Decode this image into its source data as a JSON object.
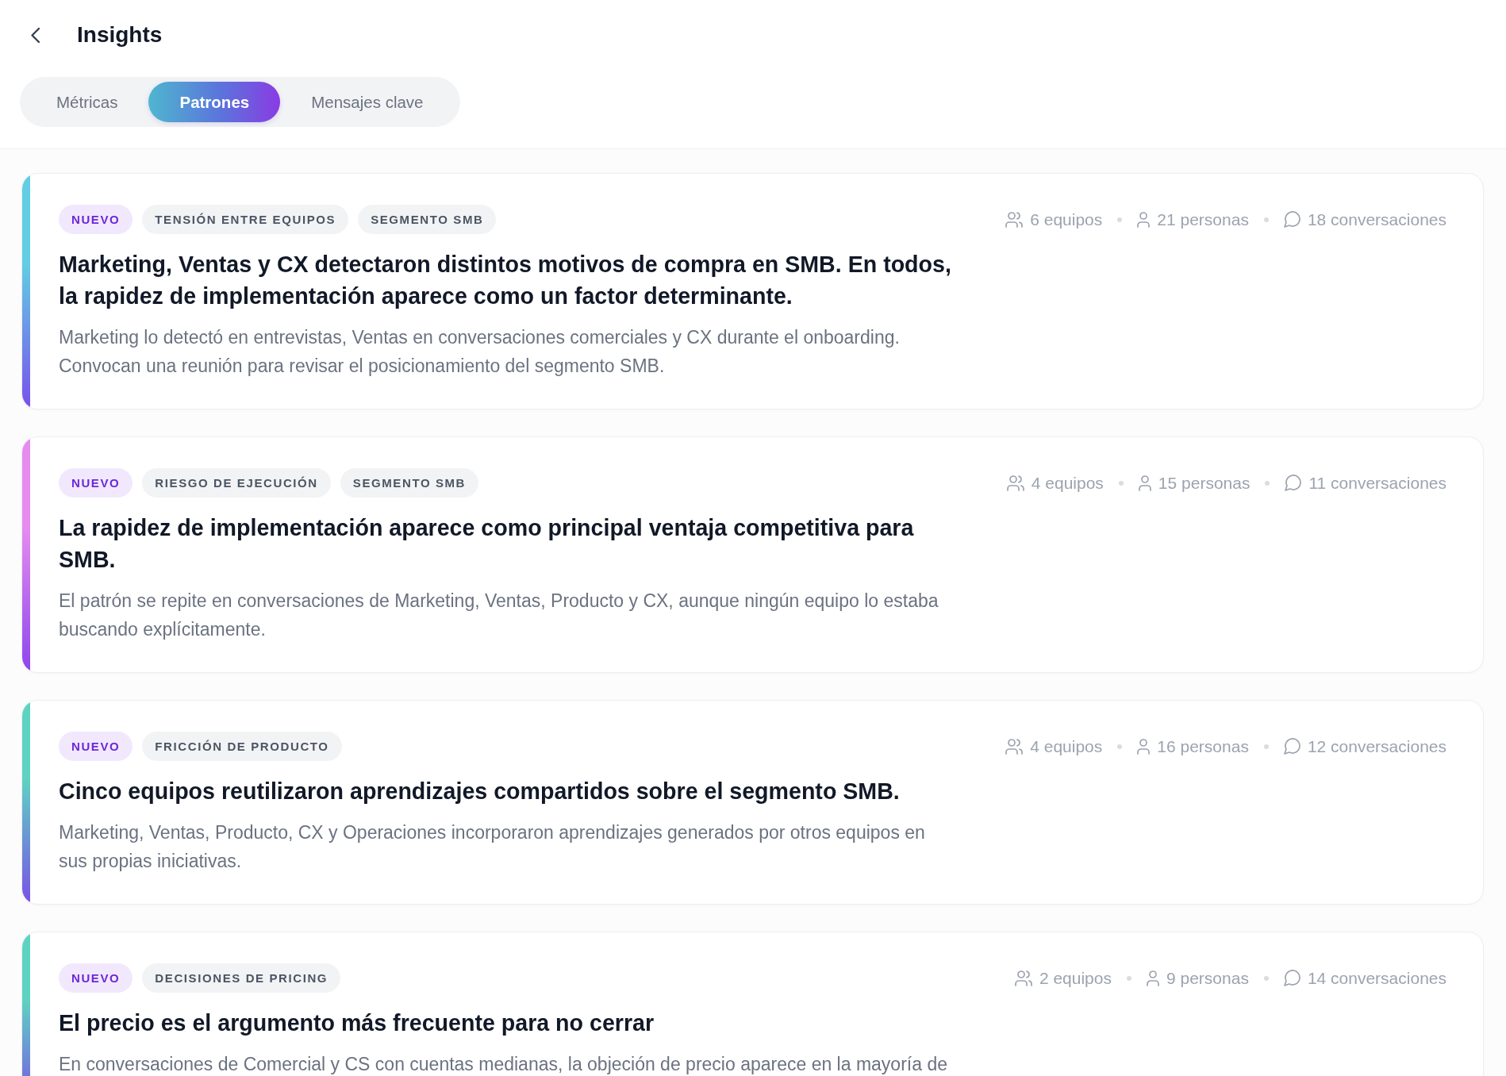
{
  "header": {
    "title": "Insights"
  },
  "tabs": [
    {
      "label": "Métricas",
      "selected": false
    },
    {
      "label": "Patrones",
      "selected": true
    },
    {
      "label": "Mensajes clave",
      "selected": false
    }
  ],
  "cards": [
    {
      "color": "#62cee3",
      "tags": [
        {
          "label": "NUEVO",
          "kind": "new"
        },
        {
          "label": "TENSIÓN ENTRE EQUIPOS",
          "kind": "topic"
        },
        {
          "label": "SEGMENTO SMB",
          "kind": "topic"
        }
      ],
      "meta": [
        {
          "kind": "teams",
          "text": "6 equipos"
        },
        {
          "kind": "people",
          "text": "21 personas"
        },
        {
          "kind": "conversations",
          "text": "18 conversaciones"
        }
      ],
      "title": "Marketing, Ventas y CX detectaron distintos motivos de compra en SMB. En todos, la rapidez de implementación aparece como un factor determinante.",
      "description": "Marketing lo detectó en entrevistas, Ventas en conversaciones comerciales y CX durante el onboarding. Convocan una reunión para revisar el posicionamiento del segmento SMB."
    },
    {
      "color": "#e68cf0",
      "tags": [
        {
          "label": "NUEVO",
          "kind": "new"
        },
        {
          "label": "RIESGO DE EJECUCIÓN",
          "kind": "topic"
        },
        {
          "label": "SEGMENTO SMB",
          "kind": "topic"
        }
      ],
      "meta": [
        {
          "kind": "teams",
          "text": "4 equipos"
        },
        {
          "kind": "people",
          "text": "15 personas"
        },
        {
          "kind": "conversations",
          "text": "11 conversaciones"
        }
      ],
      "title": "La rapidez de implementación aparece como principal ventaja competitiva para SMB.",
      "description": "El patrón se repite en conversaciones de Marketing, Ventas, Producto y CX, aunque ningún equipo lo estaba buscando explícitamente."
    },
    {
      "color": "#5fd3c2",
      "tags": [
        {
          "label": "NUEVO",
          "kind": "new"
        },
        {
          "label": "FRICCIÓN DE PRODUCTO",
          "kind": "topic"
        }
      ],
      "meta": [
        {
          "kind": "teams",
          "text": "4 equipos"
        },
        {
          "kind": "people",
          "text": "16 personas"
        },
        {
          "kind": "conversations",
          "text": "12 conversaciones"
        }
      ],
      "title": "Cinco equipos reutilizaron aprendizajes compartidos sobre el segmento SMB.",
      "description": "Marketing, Ventas, Producto, CX y Operaciones incorporaron aprendizajes generados por otros equipos en sus propias iniciativas."
    },
    {
      "color": "#5fd3c2",
      "tags": [
        {
          "label": "NUEVO",
          "kind": "new"
        },
        {
          "label": "DECISIONES DE PRICING",
          "kind": "topic"
        }
      ],
      "meta": [
        {
          "kind": "teams",
          "text": "2 equipos"
        },
        {
          "kind": "people",
          "text": "9 personas"
        },
        {
          "kind": "conversations",
          "text": "14 conversaciones"
        }
      ],
      "title": "El precio es el argumento más frecuente para no cerrar",
      "description": "En conversaciones de Comercial y CS con cuentas medianas, la objeción de precio aparece en la mayoría de"
    }
  ]
}
